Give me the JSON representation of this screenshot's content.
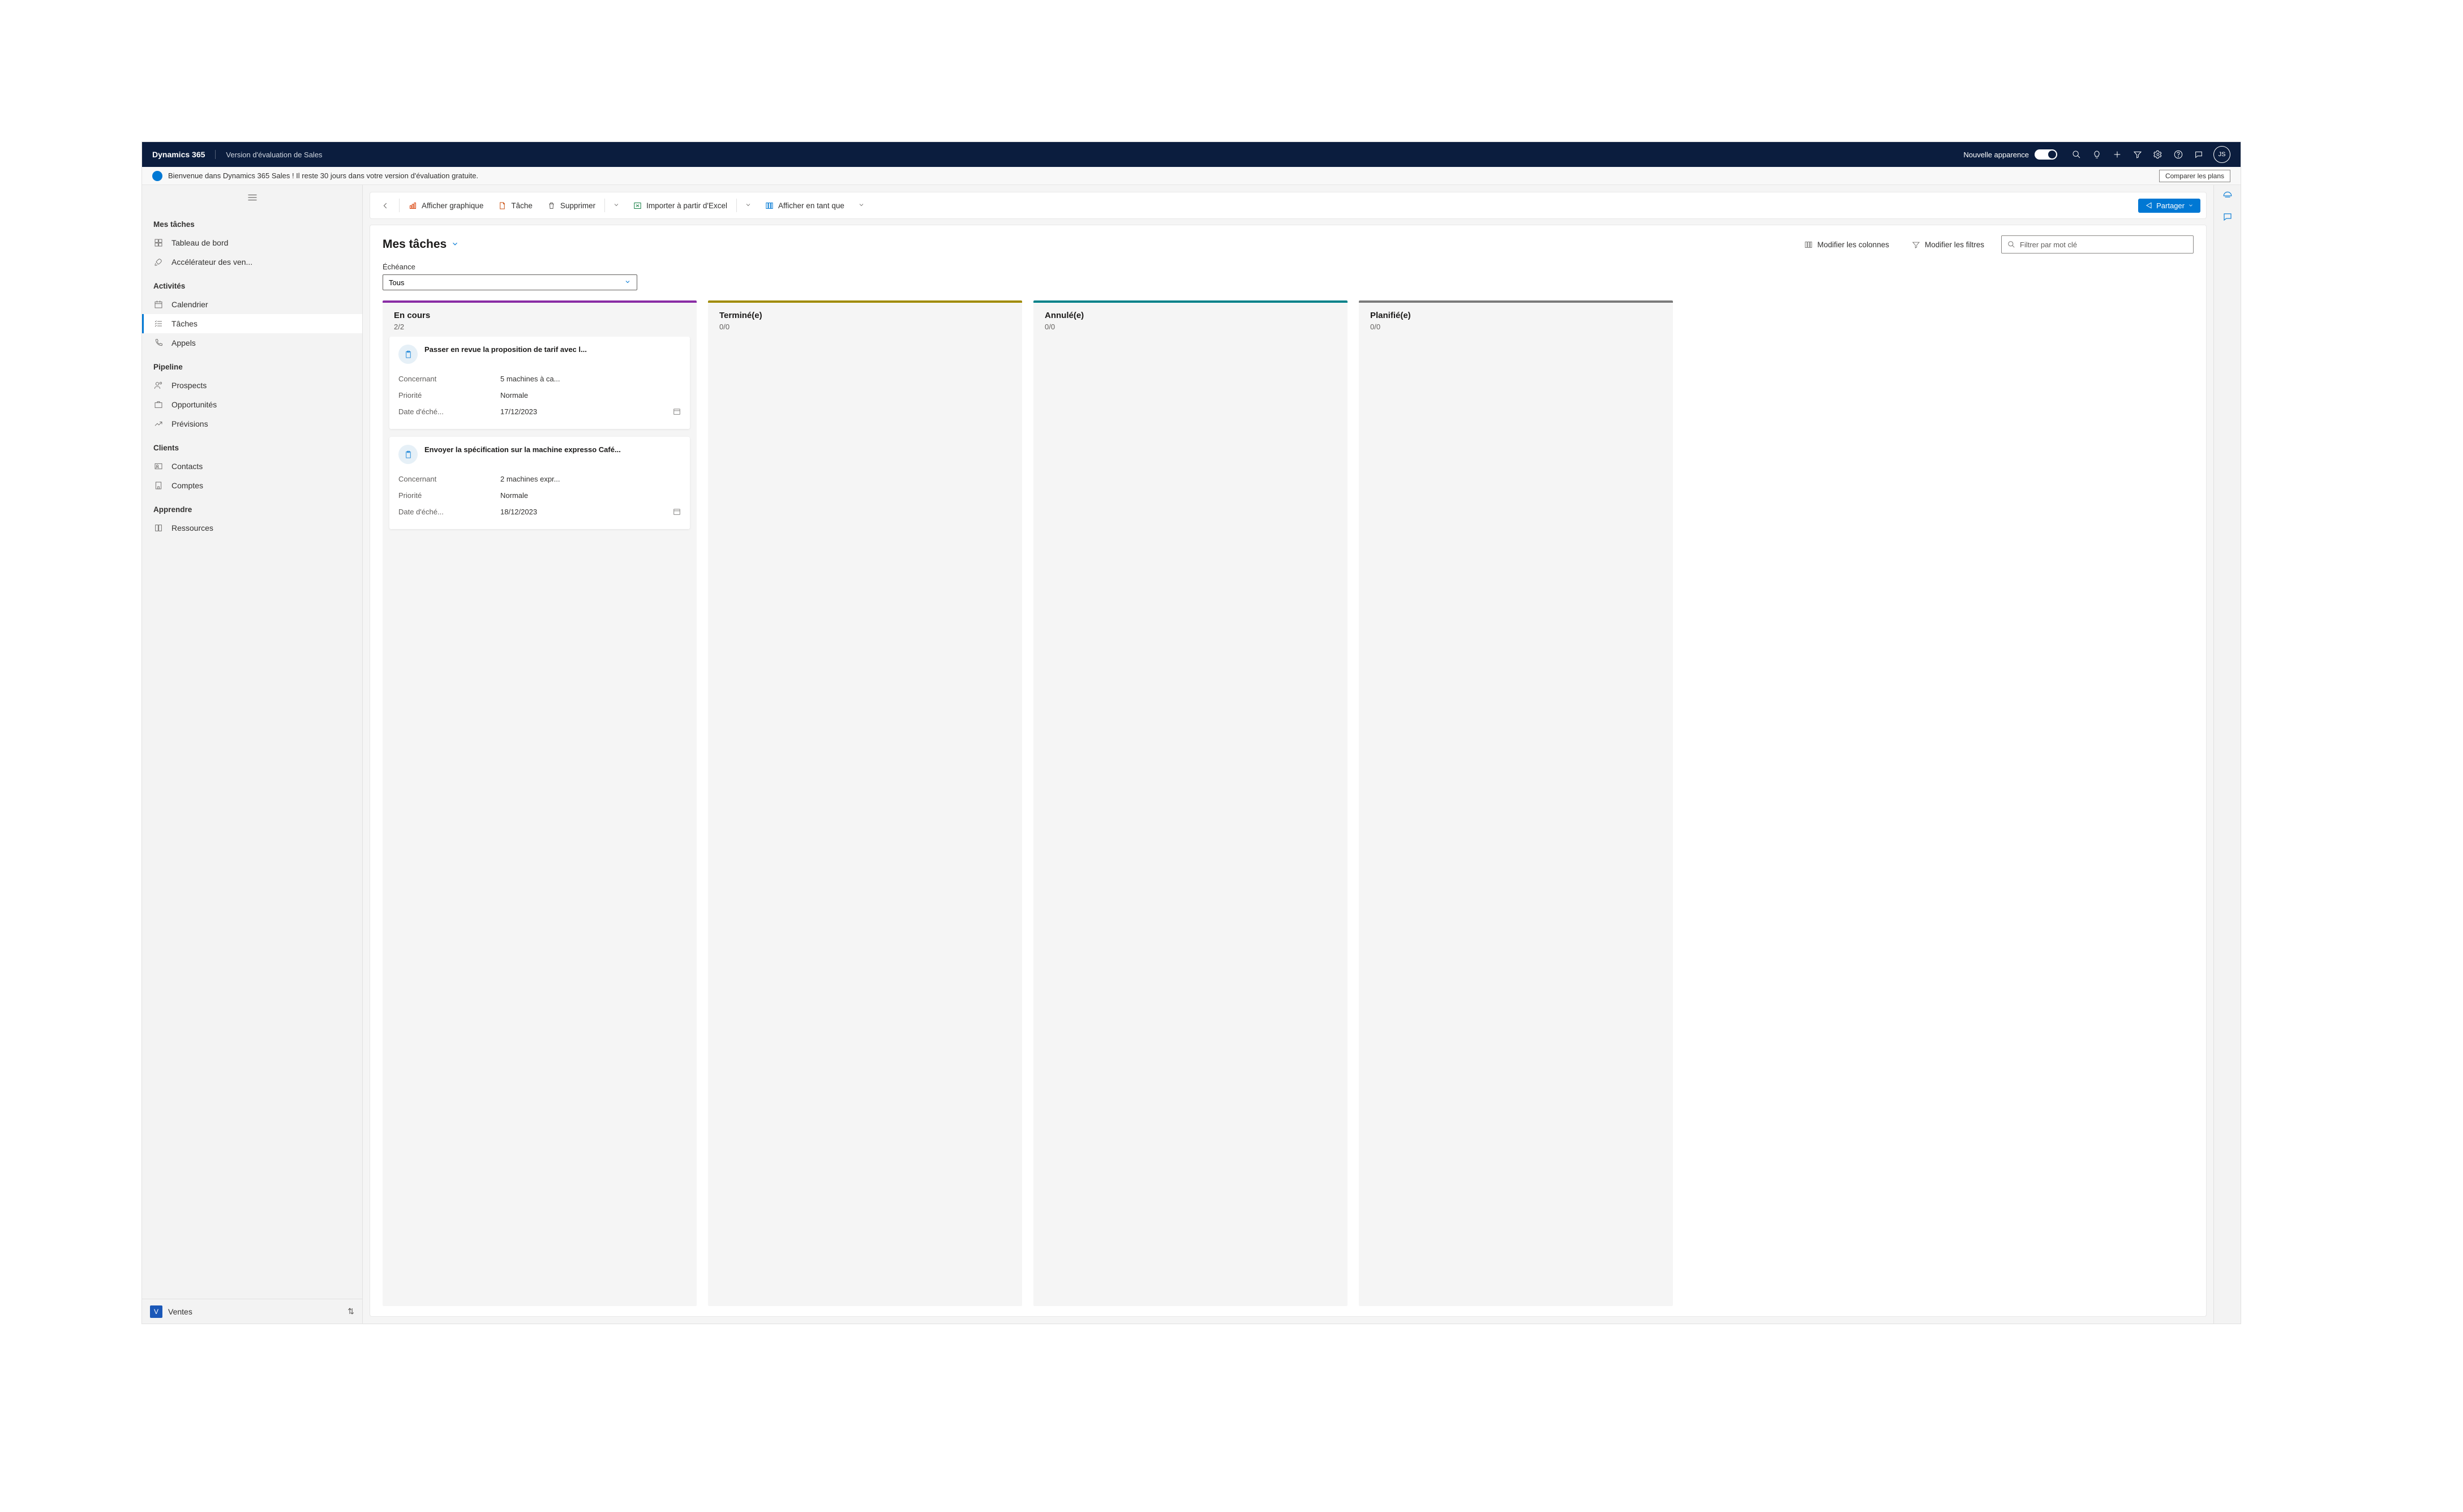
{
  "topbar": {
    "brand": "Dynamics 365",
    "subtitle": "Version d'évaluation de Sales",
    "new_look": "Nouvelle apparence",
    "avatar": "JS"
  },
  "banner": {
    "text": "Bienvenue dans Dynamics 365 Sales ! Il reste 30 jours dans votre version d'évaluation gratuite.",
    "compare": "Comparer les plans"
  },
  "sidebar": {
    "s0": "Mes tâches",
    "i0": "Tableau de bord",
    "i1": "Accélérateur des ven...",
    "s1": "Activités",
    "i2": "Calendrier",
    "i3": "Tâches",
    "i4": "Appels",
    "s2": "Pipeline",
    "i5": "Prospects",
    "i6": "Opportunités",
    "i7": "Prévisions",
    "s3": "Clients",
    "i8": "Contacts",
    "i9": "Comptes",
    "s4": "Apprendre",
    "i10": "Ressources",
    "area": "Ventes"
  },
  "cmd": {
    "chart": "Afficher graphique",
    "task": "Tâche",
    "delete": "Supprimer",
    "import": "Importer à partir d'Excel",
    "showas": "Afficher en tant que",
    "share": "Partager"
  },
  "page": {
    "title": "Mes tâches",
    "editcols": "Modifier les colonnes",
    "editfilters": "Modifier les filtres",
    "filter_ph": "Filtrer par mot clé",
    "echeance_label": "Échéance",
    "echeance_value": "Tous"
  },
  "lanes": [
    {
      "title": "En cours",
      "count": "2/2"
    },
    {
      "title": "Terminé(e)",
      "count": "0/0"
    },
    {
      "title": "Annulé(e)",
      "count": "0/0"
    },
    {
      "title": "Planifié(e)",
      "count": "0/0"
    }
  ],
  "labels": {
    "concernant": "Concernant",
    "priorite": "Priorité",
    "date": "Date d'éché..."
  },
  "cards": [
    {
      "title": "Passer en revue la proposition de tarif avec l...",
      "concernant": "5 machines à ca...",
      "priorite": "Normale",
      "date": "17/12/2023"
    },
    {
      "title": "Envoyer la spécification sur la machine expresso Café...",
      "concernant": "2 machines expr...",
      "priorite": "Normale",
      "date": "18/12/2023"
    }
  ]
}
